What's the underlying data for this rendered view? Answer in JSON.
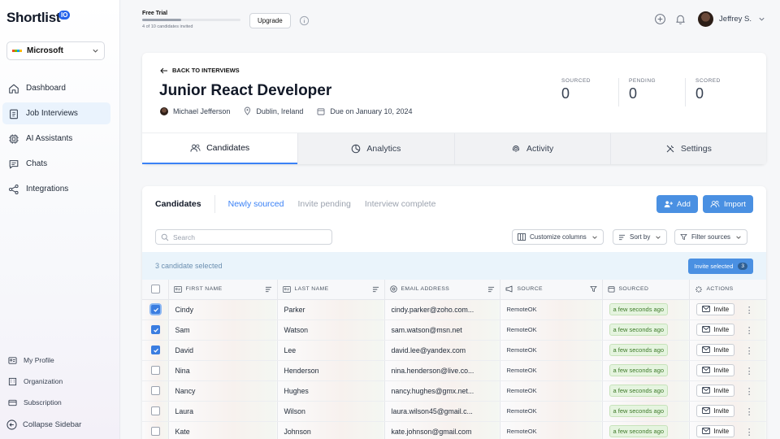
{
  "app": {
    "logo_text": "Shortlist",
    "logo_badge": "IO",
    "org": "Microsoft",
    "org_colors": [
      "#f25022",
      "#7fba00",
      "#00a4ef",
      "#ffb900"
    ]
  },
  "sidebar": {
    "items": [
      {
        "label": "Dashboard",
        "icon": "home-icon"
      },
      {
        "label": "Job Interviews",
        "icon": "clipboard-icon",
        "active": true
      },
      {
        "label": "AI Assistants",
        "icon": "cpu-icon"
      },
      {
        "label": "Chats",
        "icon": "chat-icon"
      },
      {
        "label": "Integrations",
        "icon": "share-icon"
      }
    ],
    "bottom_items": [
      {
        "label": "My Profile",
        "icon": "id-card-icon"
      },
      {
        "label": "Organization",
        "icon": "building-icon"
      },
      {
        "label": "Subscription",
        "icon": "card-icon"
      }
    ],
    "collapse_label": "Collapse Sidebar"
  },
  "topbar": {
    "trial_label": "Free Trial",
    "trial_progress": 0.4,
    "trial_sub": "4 of 10 candidates invited",
    "upgrade_label": "Upgrade",
    "user_name": "Jeffrey S."
  },
  "job": {
    "back_label": "BACK TO INTERVIEWS",
    "title": "Junior React Developer",
    "owner": "Michael Jefferson",
    "location": "Dublin, Ireland",
    "due": "Due on January 10, 2024",
    "stats": [
      {
        "label": "SOURCED",
        "value": "0"
      },
      {
        "label": "PENDING",
        "value": "0"
      },
      {
        "label": "SCORED",
        "value": "0"
      }
    ],
    "tabs": [
      {
        "label": "Candidates",
        "icon": "users-icon",
        "active": true
      },
      {
        "label": "Analytics",
        "icon": "pie-chart-icon"
      },
      {
        "label": "Activity",
        "icon": "fingerprint-icon"
      },
      {
        "label": "Settings",
        "icon": "tools-icon"
      }
    ]
  },
  "candidates": {
    "heading": "Candidates",
    "subtabs": [
      {
        "label": "Newly sourced",
        "active": true
      },
      {
        "label": "Invite pending"
      },
      {
        "label": "Interview complete"
      }
    ],
    "add_label": "Add",
    "import_label": "Import",
    "search_placeholder": "Search",
    "customize_label": "Customize columns",
    "sort_label": "Sort by",
    "filter_label": "Filter sources",
    "selected_text": "3 candidate selected",
    "invite_selected_label": "Invite selected",
    "invite_selected_count": "3",
    "columns": [
      "FIRST NAME",
      "LAST NAME",
      "EMAIL ADDRESS",
      "SOURCE",
      "SOURCED",
      "ACTIONS"
    ],
    "invite_label": "Invite",
    "rows": [
      {
        "first": "Cindy",
        "last": "Parker",
        "email": "cindy.parker@zoho.com...",
        "source": "RemoteOK",
        "sourced": "a few seconds ago",
        "checked": true,
        "focus": true
      },
      {
        "first": "Sam",
        "last": "Watson",
        "email": "sam.watson@msn.net",
        "source": "RemoteOK",
        "sourced": "a few seconds ago",
        "checked": true
      },
      {
        "first": "David",
        "last": "Lee",
        "email": "david.lee@yandex.com",
        "source": "RemoteOK",
        "sourced": "a few seconds ago",
        "checked": true
      },
      {
        "first": "Nina",
        "last": "Henderson",
        "email": "nina.henderson@live.co...",
        "source": "RemoteOK",
        "sourced": "a few seconds ago",
        "checked": false
      },
      {
        "first": "Nancy",
        "last": "Hughes",
        "email": "nancy.hughes@gmx.net...",
        "source": "RemoteOK",
        "sourced": "a few seconds ago",
        "checked": false
      },
      {
        "first": "Laura",
        "last": "Wilson",
        "email": "laura.wilson45@gmail.c...",
        "source": "RemoteOK",
        "sourced": "a few seconds ago",
        "checked": false
      },
      {
        "first": "Kate",
        "last": "Johnson",
        "email": "kate.johnson@gmail.com",
        "source": "RemoteOK",
        "sourced": "a few seconds ago",
        "checked": false
      }
    ]
  }
}
